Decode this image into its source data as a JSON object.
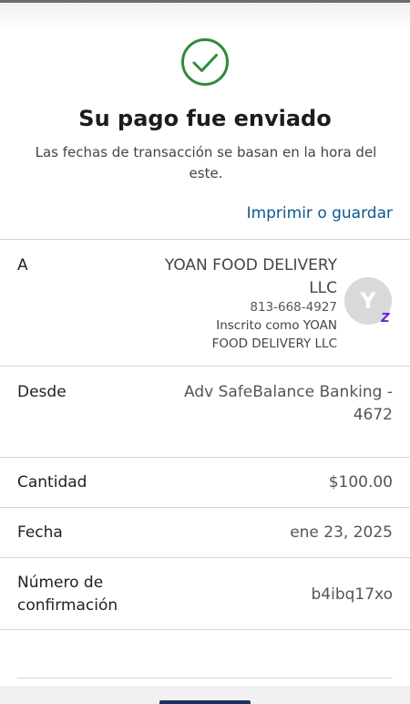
{
  "header": {
    "title": "Su pago fue enviado",
    "subtitle": "Las fechas de transacción se basan en la hora del este.",
    "print_link": "Imprimir o guardar",
    "status_icon": "check-circle-icon"
  },
  "details": {
    "to": {
      "label": "A",
      "name": "YOAN FOOD DELIVERY LLC",
      "phone": "813-668-4927",
      "enrolled": "Inscrito como YOAN FOOD DELIVERY LLC",
      "avatar_initial": "Y",
      "badge_icon": "zelle-icon"
    },
    "from": {
      "label": "Desde",
      "value": "Adv SafeBalance Banking - 4672"
    },
    "amount": {
      "label": "Cantidad",
      "value": "$100.00"
    },
    "date": {
      "label": "Fecha",
      "value": "ene 23, 2025"
    },
    "confirmation": {
      "label": "Número de confirmación",
      "value": "b4ibq17xo"
    }
  },
  "colors": {
    "success": "#2e8b3a",
    "link": "#0b5a8e",
    "zelle": "#6d1ed4"
  }
}
